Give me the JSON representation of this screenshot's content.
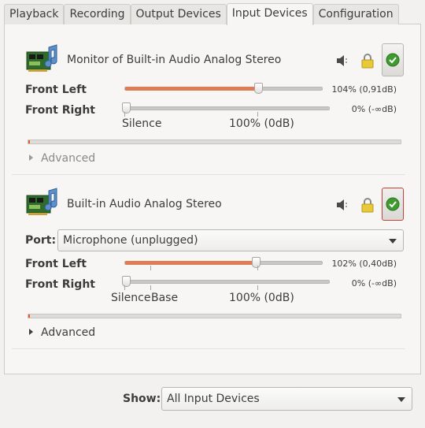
{
  "tabs": [
    {
      "label": "Playback"
    },
    {
      "label": "Recording"
    },
    {
      "label": "Output Devices"
    },
    {
      "label": "Input Devices"
    },
    {
      "label": "Configuration"
    }
  ],
  "active_tab": "Input Devices",
  "devices": [
    {
      "name": "Monitor of Built-in Audio Analog Stereo",
      "icon": "audio-card-icon",
      "mute_icon": "speaker-icon",
      "lock_icon": "lock-icon",
      "default_icon": "checkmark-icon",
      "channels": [
        {
          "label": "Front Left",
          "value_text": "104% (0,91dB)",
          "level_percent": 104
        },
        {
          "label": "Front Right",
          "value_text": "0% (-∞dB)",
          "level_percent": 0
        }
      ],
      "scale_marks": {
        "silence": "Silence",
        "hundred": "100% (0dB)"
      },
      "advanced_label": "Advanced"
    },
    {
      "name": "Built-in Audio Analog Stereo",
      "icon": "audio-card-icon",
      "mute_icon": "speaker-icon",
      "lock_icon": "lock-icon",
      "default_icon": "checkmark-icon",
      "port_label": "Port:",
      "port_value": "Microphone (unplugged)",
      "channels": [
        {
          "label": "Front Left",
          "value_text": "102% (0,40dB)",
          "level_percent": 102
        },
        {
          "label": "Front Right",
          "value_text": "0% (-∞dB)",
          "level_percent": 0
        }
      ],
      "scale_marks": {
        "silence": "Silence",
        "base": "Base",
        "hundred": "100% (0dB)"
      },
      "advanced_label": "Advanced"
    }
  ],
  "show": {
    "label": "Show:",
    "value": "All Input Devices"
  },
  "colors": {
    "slider_fill": "#de7c55",
    "meter": "#e8592e",
    "default_active_border": "#c0433a",
    "check_green": "#3f9a2f"
  }
}
